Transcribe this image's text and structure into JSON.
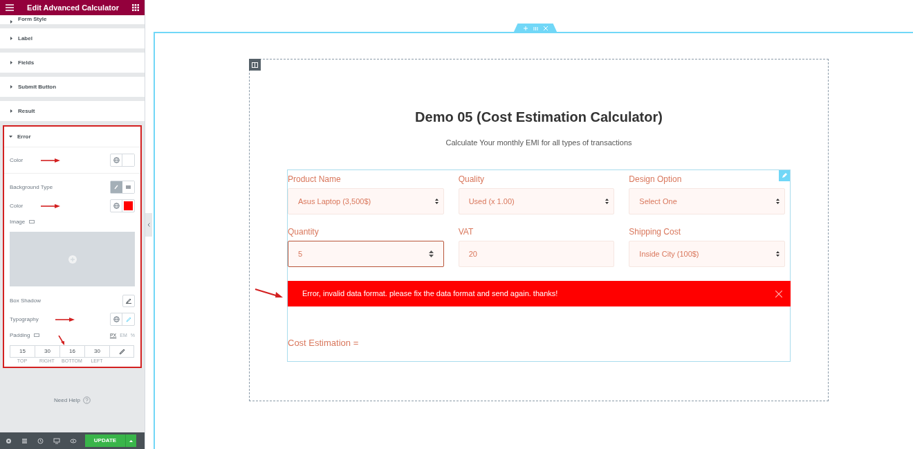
{
  "panel": {
    "title": "Edit Advanced Calculator",
    "sections": [
      {
        "label": "Form Style",
        "expanded": false
      },
      {
        "label": "Label",
        "expanded": false
      },
      {
        "label": "Fields",
        "expanded": false
      },
      {
        "label": "Submit Button",
        "expanded": false
      },
      {
        "label": "Result",
        "expanded": false
      },
      {
        "label": "Error",
        "expanded": true
      }
    ],
    "error_color": {
      "label": "Color",
      "color": "#ffffff"
    },
    "background_type": {
      "label": "Background Type",
      "options": [
        {
          "selected": true
        },
        {
          "selected": false
        }
      ]
    },
    "background_color": {
      "label": "Color",
      "color": "#ff0000"
    },
    "image_label": "Image",
    "box_shadow_label": "Box Shadow",
    "typography_label": "Typography",
    "padding": {
      "label": "Padding",
      "units": [
        {
          "label": "PX",
          "selected": true
        },
        {
          "label": "EM",
          "selected": false
        },
        {
          "label": "%",
          "selected": false
        }
      ],
      "values": [
        {
          "value": "15",
          "caption": "TOP"
        },
        {
          "value": "30",
          "caption": "RIGHT"
        },
        {
          "value": "16",
          "caption": "BOTTOM"
        },
        {
          "value": "30",
          "caption": "LEFT"
        }
      ]
    },
    "help": "Need Help",
    "update": "UPDATE"
  },
  "canvas": {
    "title": "Demo 05 (Cost Estimation Calculator)",
    "subtitle": "Calculate Your monthly EMI for all types of transactions",
    "fields": [
      {
        "label": "Product Name",
        "kind": "select",
        "value": "Asus Laptop (3,500$)",
        "focused": false
      },
      {
        "label": "Quality",
        "kind": "select",
        "value": "Used (x 1.00)",
        "focused": false
      },
      {
        "label": "Design Option",
        "kind": "select",
        "value": "Select One",
        "focused": false
      },
      {
        "label": "Quantity",
        "kind": "number",
        "value": "5",
        "focused": true
      },
      {
        "label": "VAT",
        "kind": "text",
        "value": "20",
        "focused": false
      },
      {
        "label": "Shipping Cost",
        "kind": "select",
        "value": "Inside City (100$)",
        "focused": false
      }
    ],
    "error": "Error, invalid data format. please fix the data format and send again. thanks!",
    "result_label": "Cost Estimation ="
  }
}
